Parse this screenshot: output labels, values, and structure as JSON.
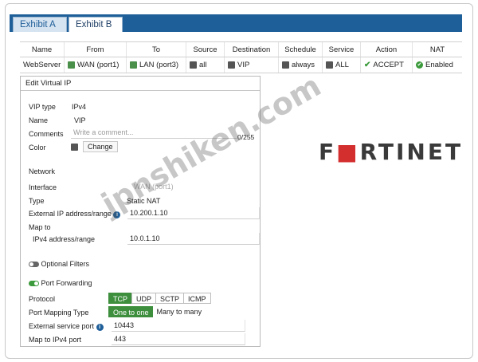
{
  "tabs": [
    {
      "label": "Exhibit A",
      "active": false
    },
    {
      "label": "Exhibit B",
      "active": true
    }
  ],
  "policy_table": {
    "headers": [
      "Name",
      "From",
      "To",
      "Source",
      "Destination",
      "Schedule",
      "Service",
      "Action",
      "NAT"
    ],
    "row": {
      "name": "WebServer",
      "from": "WAN (port1)",
      "to": "LAN (port3)",
      "source": "all",
      "destination": "VIP",
      "schedule": "always",
      "service": "ALL",
      "action": "ACCEPT",
      "nat": "Enabled"
    }
  },
  "panel": {
    "title": "Edit Virtual IP",
    "vip_type_label": "VIP type",
    "vip_type_value": "IPv4",
    "name_label": "Name",
    "name_value": "VIP",
    "comments_label": "Comments",
    "comments_placeholder": "Write a comment...",
    "comments_counter": "0/255",
    "color_label": "Color",
    "color_button": "Change",
    "network_heading": "Network",
    "interface_label": "Interface",
    "interface_value": "WAN (port1)",
    "type_label": "Type",
    "type_value": "Static NAT",
    "ext_ip_label": "External IP address/range",
    "ext_ip_value": "10.200.1.10",
    "map_to_label": "Map to",
    "ipv4_range_label": "IPv4 address/range",
    "ipv4_range_value": "10.0.1.10",
    "optional_filters_label": "Optional Filters",
    "optional_filters_on": false,
    "port_forwarding_label": "Port Forwarding",
    "port_forwarding_on": true,
    "protocol_label": "Protocol",
    "protocols": [
      "TCP",
      "UDP",
      "SCTP",
      "ICMP"
    ],
    "protocol_selected": "TCP",
    "port_mapping_label": "Port Mapping Type",
    "port_mapping_options": [
      "One to one",
      "Many to many"
    ],
    "port_mapping_selected": "One to one",
    "ext_port_label": "External service port",
    "ext_port_value": "10443",
    "map_port_label": "Map to IPv4 port",
    "map_port_value": "443"
  },
  "logo": {
    "text_a": "F",
    "text_b": "RTINET"
  },
  "watermark": "jpnshiken.com",
  "colors": {
    "accent": "#1f5f99",
    "active": "#3d8f3d"
  }
}
